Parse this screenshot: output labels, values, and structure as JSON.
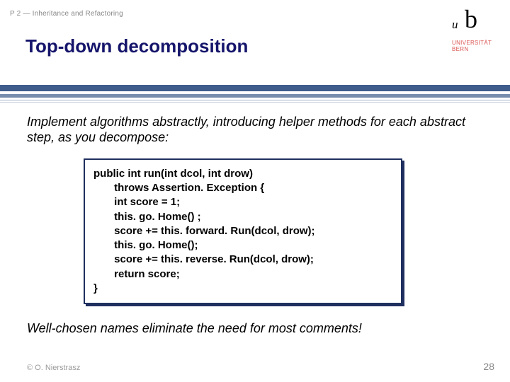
{
  "header": {
    "breadcrumb": "P 2 — Inheritance and Refactoring",
    "title": "Top-down decomposition",
    "logo": {
      "u": "u",
      "b": "b",
      "line1": "UNIVERSITÄT",
      "line2": "BERN"
    }
  },
  "body": {
    "lead": "Implement algorithms abstractly, introducing helper methods for each abstract step, as you decompose:",
    "code": {
      "l0": "public int run(int dcol, int drow)",
      "l1": "       throws Assertion. Exception {",
      "l2": "       int score = 1;",
      "l3": "       this. go. Home() ;",
      "l4": "       score += this. forward. Run(dcol, drow);",
      "l5": "       this. go. Home();",
      "l6": "       score += this. reverse. Run(dcol, drow);",
      "l7": "       return score;",
      "l8": "}"
    },
    "commentary": "Well-chosen names eliminate the need for most comments!"
  },
  "footer": {
    "copyright": "© O. Nierstrasz",
    "pagenum": "28"
  }
}
